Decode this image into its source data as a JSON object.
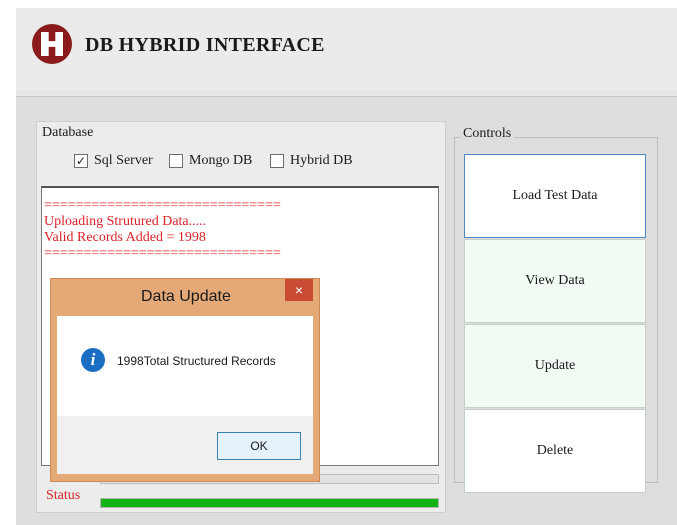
{
  "header": {
    "title": "DB HYBRID INTERFACE",
    "logo_icon": "crest-logo"
  },
  "database": {
    "label": "Database",
    "options": [
      {
        "label": "Sql Server",
        "checked": true,
        "mark": "✓"
      },
      {
        "label": "Mongo DB",
        "checked": false,
        "mark": ""
      },
      {
        "label": "Hybrid DB",
        "checked": false,
        "mark": ""
      }
    ],
    "log_lines": [
      "==============================",
      "Uploading Strutured Data.....",
      "Valid Records Added = 1998",
      "=============================="
    ]
  },
  "status": {
    "label": "Status",
    "progress": 1.0,
    "progress_color": "#14b314"
  },
  "controls": {
    "label": "Controls",
    "buttons": [
      "Load Test Data",
      "View Data",
      "Update",
      "Delete"
    ]
  },
  "dialog": {
    "title": "Data Update",
    "close_glyph": "×",
    "info_glyph": "i",
    "message": "1998Total Structured Records",
    "ok_label": "OK"
  },
  "colors": {
    "log_text": "#d9222a",
    "accent_border": "#4e88c8",
    "dialog_frame": "#e5a978",
    "close_button": "#c94b33"
  }
}
